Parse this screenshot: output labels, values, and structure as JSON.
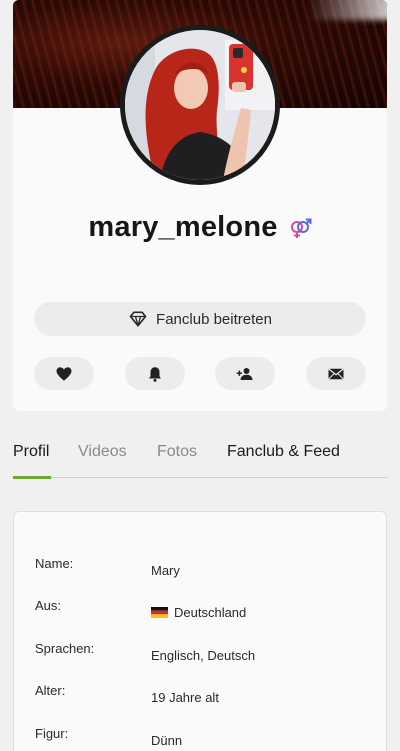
{
  "profile": {
    "username": "mary_melone",
    "gender_icon": "gender-mars-venus-icon",
    "fanclub_button_label": "Fanclub beitreten",
    "actions": [
      {
        "name": "like",
        "icon": "heart-icon"
      },
      {
        "name": "notify",
        "icon": "bell-icon"
      },
      {
        "name": "follow",
        "icon": "add-user-icon"
      },
      {
        "name": "message",
        "icon": "envelope-icon"
      }
    ]
  },
  "tabs": [
    {
      "label": "Profil",
      "active": true
    },
    {
      "label": "Videos",
      "active": false
    },
    {
      "label": "Fotos",
      "active": false
    },
    {
      "label": "Fanclub & Feed",
      "active": false
    }
  ],
  "details": [
    {
      "label": "Name:",
      "value": "Mary"
    },
    {
      "label": "Aus:",
      "value": "Deutschland",
      "flag": "germany-flag-icon"
    },
    {
      "label": "Sprachen:",
      "value": "Englisch, Deutsch"
    },
    {
      "label": "Alter:",
      "value": "19 Jahre alt"
    },
    {
      "label": "Figur:",
      "value": "Dünn"
    }
  ],
  "colors": {
    "accent": "#6aa832",
    "background": "#f0f0f0",
    "card": "#fafafa",
    "button": "#ececec",
    "gender_blue": "#5b6bd6",
    "gender_pink": "#d64b9a"
  }
}
